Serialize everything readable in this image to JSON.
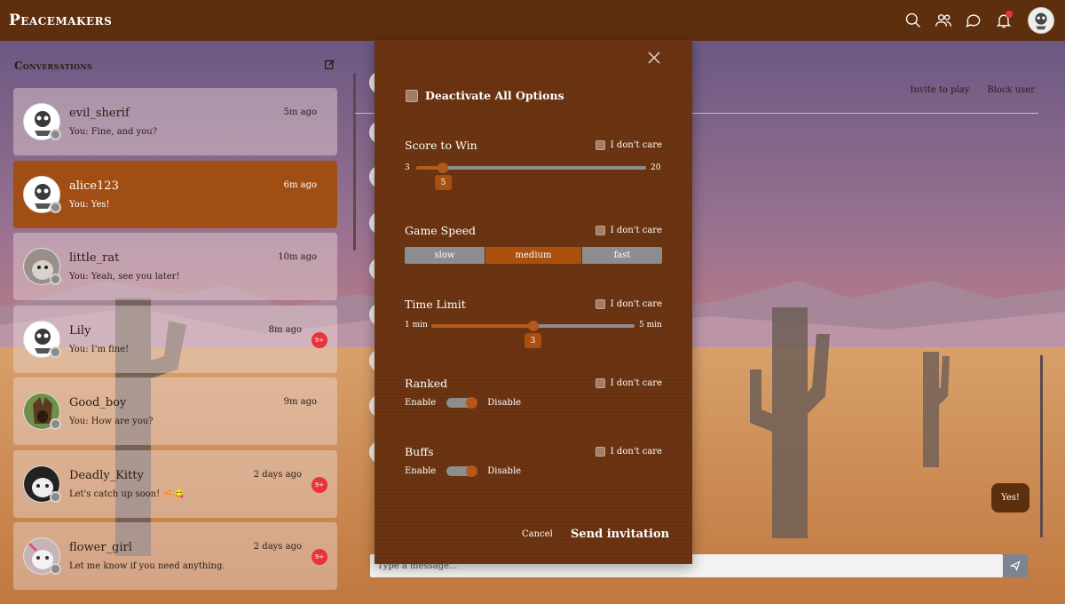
{
  "app": {
    "brand": "Peacemakers"
  },
  "topbar": {
    "icons": [
      "search-icon",
      "friends-icon",
      "chat-icon",
      "bell-icon",
      "user-avatar"
    ],
    "notification_dot_color": "#e8333f"
  },
  "sidebar": {
    "title": "Conversations",
    "conversations": [
      {
        "name": "evil_sherif",
        "time": "5m ago",
        "message": "You: Fine, and you?",
        "active": false,
        "badge": ""
      },
      {
        "name": "alice123",
        "time": "6m ago",
        "message": "You: Yes!",
        "active": true,
        "badge": ""
      },
      {
        "name": "little_rat",
        "time": "10m ago",
        "message": "You: Yeah, see you later!",
        "active": false,
        "badge": ""
      },
      {
        "name": "Lily",
        "time": "8m ago",
        "message": "You: I'm fine!",
        "active": false,
        "badge": "9+"
      },
      {
        "name": "Good_boy",
        "time": "9m ago",
        "message": "You: How are you?",
        "active": false,
        "badge": ""
      },
      {
        "name": "Deadly_Kitty",
        "time": "2 days ago",
        "message": "Let's catch up soon! 🍕😋",
        "active": false,
        "badge": "9+"
      },
      {
        "name": "flower_girl",
        "time": "2 days ago",
        "message": "Let me know if you need anything.",
        "active": false,
        "badge": "9+"
      }
    ]
  },
  "chat": {
    "invite_label": "Invite to play",
    "block_label": "Block user",
    "last_message": "Yes!",
    "input_placeholder": "Type a message..."
  },
  "modal": {
    "deactivate_label": "Deactivate All Options",
    "dont_care_label": "I don't care",
    "score": {
      "title": "Score to Win",
      "min": "3",
      "max": "20",
      "value": "5",
      "min_num": 3,
      "max_num": 20,
      "value_num": 5
    },
    "speed": {
      "title": "Game Speed",
      "options": [
        "slow",
        "medium",
        "fast"
      ],
      "selected": "medium"
    },
    "time": {
      "title": "Time Limit",
      "min": "1 min",
      "max": "5 min",
      "value": "3",
      "min_num": 1,
      "max_num": 5,
      "value_num": 3
    },
    "ranked": {
      "title": "Ranked",
      "enable": "Enable",
      "disable": "Disable"
    },
    "buffs": {
      "title": "Buffs",
      "enable": "Enable",
      "disable": "Disable"
    },
    "cancel_label": "Cancel",
    "send_label": "Send invitation"
  },
  "colors": {
    "topbar": "#5e2f0e",
    "accent": "#a04e14",
    "modal_bg": "#6b3412",
    "badge": "#e8333f"
  }
}
